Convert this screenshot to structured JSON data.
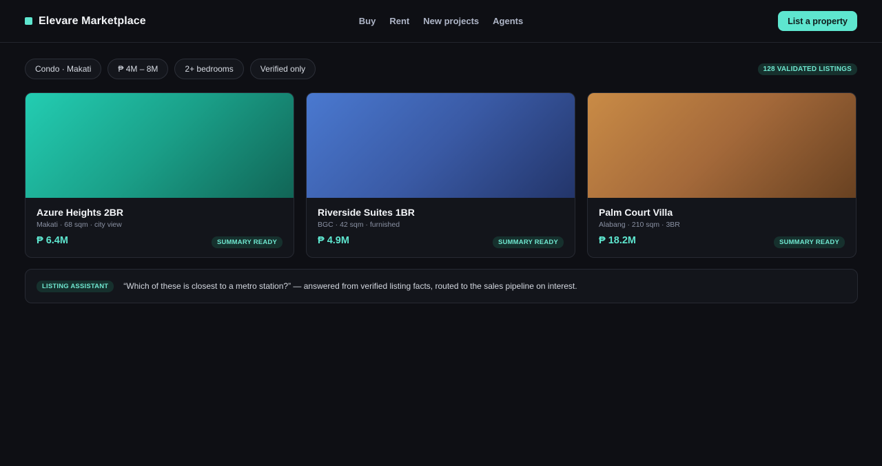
{
  "header": {
    "brand": "Elevare Marketplace",
    "nav": [
      "Buy",
      "Rent",
      "New projects",
      "Agents"
    ],
    "cta": "List a property"
  },
  "filters": {
    "chips": [
      "Condo · Makati",
      "₱ 4M – 8M",
      "2+ bedrooms",
      "Verified only"
    ],
    "count_badge": "128 VALIDATED LISTINGS"
  },
  "listings": [
    {
      "title": "Azure Heights 2BR",
      "meta": "Makati · 68 sqm · city view",
      "price": "₱ 6.4M",
      "badge": "SUMMARY READY",
      "image_color": "#1fb89e"
    },
    {
      "title": "Riverside Suites 1BR",
      "meta": "BGC · 42 sqm · furnished",
      "price": "₱ 4.9M",
      "badge": "SUMMARY READY",
      "image_color": "#3a5aa5"
    },
    {
      "title": "Palm Court Villa",
      "meta": "Alabang · 210 sqm · 3BR",
      "price": "₱ 18.2M",
      "badge": "SUMMARY READY",
      "image_color": "#a4693a"
    }
  ],
  "assistant": {
    "tag": "LISTING ASSISTANT",
    "text": "“Which of these is closest to a metro station?” — answered from verified listing facts, routed to the sales pipeline on interest."
  },
  "colors": {
    "accent": "#5ee6cf",
    "background": "#0e0f14"
  }
}
